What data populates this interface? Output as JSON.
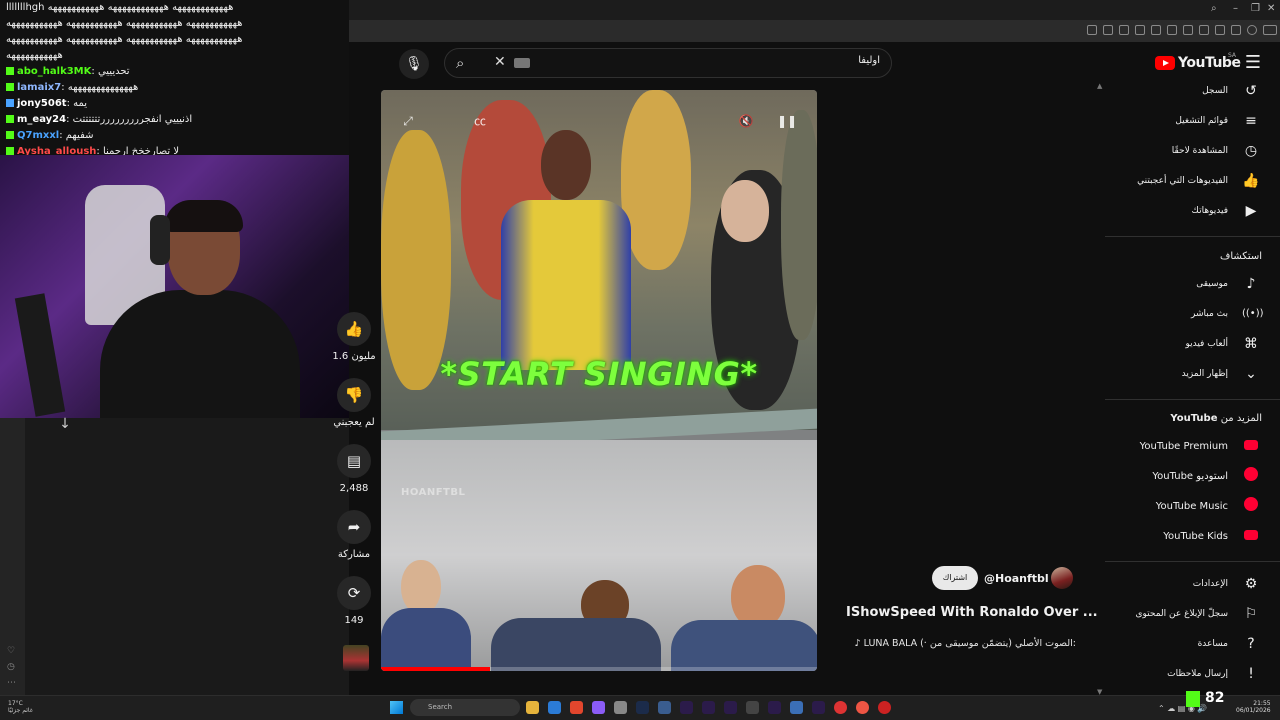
{
  "chat": {
    "lines": [
      {
        "user": "",
        "text": "اااااااhgh ههههههههههههه ههههههههههههه هههههههههههه",
        "color": "#53fc18"
      },
      {
        "user": "",
        "text": "هههههههههههه هههههههههههه هههههههههههه هههههههههههه",
        "color": "#eeeeee"
      },
      {
        "user": "",
        "text": "هههههههههههه هههههههههههه هههههههههههه هههههههههههه",
        "color": "#eeeeee"
      },
      {
        "user": "",
        "text": "هههههههههههه",
        "color": "#eeeeee"
      },
      {
        "user": "abo_halk3MK",
        "text": ": تحديييي",
        "color": "#53fc18"
      },
      {
        "user": "lamaix7",
        "text": ": ههههههههههههههه",
        "color": "#8fb7ff"
      },
      {
        "user": "jony506t",
        "text": ": يمه",
        "color": "#ffffff"
      },
      {
        "user": "m_eay24",
        "text": ": اذنيييي انفجرررررررررتتتتتتت",
        "color": "#ffffff"
      },
      {
        "user": "Q7mxxl",
        "text": ": شفيهم",
        "color": "#4aa3ff"
      },
      {
        "user": "Aysha_alloush",
        "text": ": لا تصارخخخ ارحمنا",
        "color": "#ff4a4a"
      }
    ]
  },
  "search": {
    "query": "اوليفا",
    "mic_icon": "microphone-icon",
    "search_icon": "search-icon",
    "clear_icon": "close-icon"
  },
  "header": {
    "logo_text": "YouTube",
    "region": "SA"
  },
  "sidebar": {
    "items": [
      {
        "label": "السجل",
        "icon": "history-icon",
        "glyph": "↺"
      },
      {
        "label": "قوائم التشغيل",
        "icon": "playlist-icon",
        "glyph": "≡"
      },
      {
        "label": "المشاهدة لاحقًا",
        "icon": "clock-icon",
        "glyph": "◷"
      },
      {
        "label": "الفيديوهات التي أعجبتني",
        "icon": "thumb-up-icon",
        "glyph": "👍"
      },
      {
        "label": "فيديوهاتك",
        "icon": "video-icon",
        "glyph": "▶"
      }
    ],
    "explore_heading": "استكشاف",
    "explore": [
      {
        "label": "موسيقى",
        "icon": "music-icon",
        "glyph": "♪"
      },
      {
        "label": "بث مباشر",
        "icon": "live-icon",
        "glyph": "((•))"
      },
      {
        "label": "ألعاب فيديو",
        "icon": "gamepad-icon",
        "glyph": "⌘"
      },
      {
        "label": "إظهار المزيد",
        "icon": "chevron-down-icon",
        "glyph": "⌄"
      }
    ],
    "more_heading_prefix": "المزيد من",
    "more_heading_brand": "YouTube",
    "more": [
      {
        "label": "YouTube Premium",
        "icon": "youtube-premium-icon"
      },
      {
        "label": "YouTube استوديو",
        "icon": "youtube-studio-icon"
      },
      {
        "label": "YouTube Music",
        "icon": "youtube-music-icon"
      },
      {
        "label": "YouTube Kids",
        "icon": "youtube-kids-icon"
      }
    ],
    "footer": [
      {
        "label": "الإعدادات",
        "icon": "gear-icon",
        "glyph": "⚙"
      },
      {
        "label": "سجلّ الإبلاغ عن المحتوى",
        "icon": "flag-icon",
        "glyph": "⚐"
      },
      {
        "label": "مساعدة",
        "icon": "help-icon",
        "glyph": "?"
      },
      {
        "label": "إرسال ملاحظات",
        "icon": "feedback-icon",
        "glyph": "!"
      }
    ]
  },
  "video": {
    "caption": "*START SINGING*",
    "watermark": "HOANFTBL",
    "progress": 0.25
  },
  "actions": {
    "likes": "1.6 مليون",
    "dislike": "لم يعجبني",
    "comments": "2,488",
    "share": "مشاركة",
    "remix": "149"
  },
  "channel": {
    "handle": "@Hoanftbl",
    "subscribe": "اشتراك",
    "title": "IShowSpeed With Ronaldo Over ...",
    "music": "♪ LUNA BALA (· الصوت الأصلي (يتضمّن موسيقى من:"
  },
  "taskbar": {
    "weather_temp": "17°C",
    "weather_desc": "غائم جزئيًا",
    "search_label": "Search",
    "kick_count": "82",
    "time": "21:55",
    "date": "06/01/2026"
  }
}
